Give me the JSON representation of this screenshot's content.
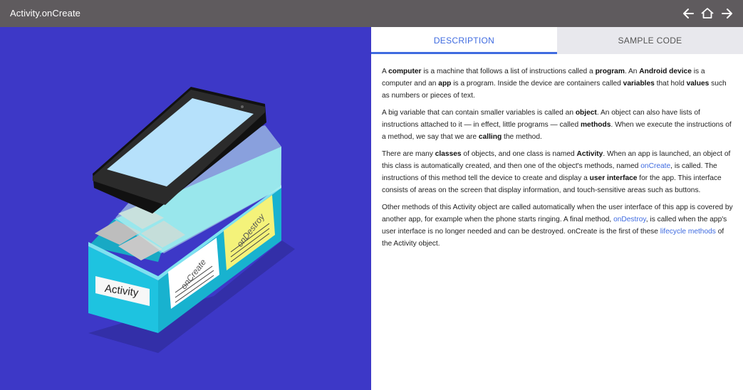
{
  "window": {
    "title": "Activity.onCreate"
  },
  "nav": {
    "back_icon": "arrow-left-icon",
    "home_icon": "home-icon",
    "forward_icon": "arrow-right-icon"
  },
  "tabs": [
    {
      "label": "DESCRIPTION",
      "active": true
    },
    {
      "label": "SAMPLE CODE",
      "active": false
    }
  ],
  "illustration": {
    "box_label": "Activity",
    "note_oncreate": "onCreate",
    "note_ondestroy": "onDestroy",
    "colors": {
      "background": "#3d38c7",
      "box": "#1ec3e0",
      "note_yellow": "#f4f27a",
      "screen": "#b6e1fb"
    }
  },
  "description": {
    "p1": {
      "s1": "A ",
      "b1": "computer",
      "s2": " is a machine that follows a list of instructions called a ",
      "b2": "program",
      "s3": ". An ",
      "b3": "Android device",
      "s4": " is a computer and an ",
      "b4": "app",
      "s5": " is a program. Inside the device are containers called ",
      "b5": "variables",
      "s6": " that hold ",
      "b6": "values",
      "s7": " such as numbers or pieces of text."
    },
    "p2": {
      "s1": "A big variable that can contain smaller variables is called an ",
      "b1": "object",
      "s2": ". An object can also have lists of instructions attached to it — in effect, little programs — called ",
      "b2": "methods",
      "s3": ". When we execute the instructions of a method, we say that we are ",
      "b3": "calling",
      "s4": " the method."
    },
    "p3": {
      "s1": "There are many ",
      "b1": "classes",
      "s2": " of objects, and one class is named ",
      "b2": "Activity",
      "s3": ". When an app is launched, an object of this class is automatically created, and then one of the object's methods, named ",
      "l1": "onCreate",
      "s4": ", is called. The instructions of this method tell the device to create and display a ",
      "b3": "user interface",
      "s5": " for the app. This interface consists of areas on the screen that display information, and touch-sensitive areas such as buttons."
    },
    "p4": {
      "s1": "Other methods of this Activity object are called automatically when the user interface of this app is covered by another app, for example when the phone starts ringing. A final method, ",
      "l1": "onDestroy",
      "s2": ", is called when the app's user interface is no longer needed and can be destroyed. onCreate is the first of these ",
      "l2": "lifecycle methods",
      "s3": " of the Activity object."
    }
  }
}
